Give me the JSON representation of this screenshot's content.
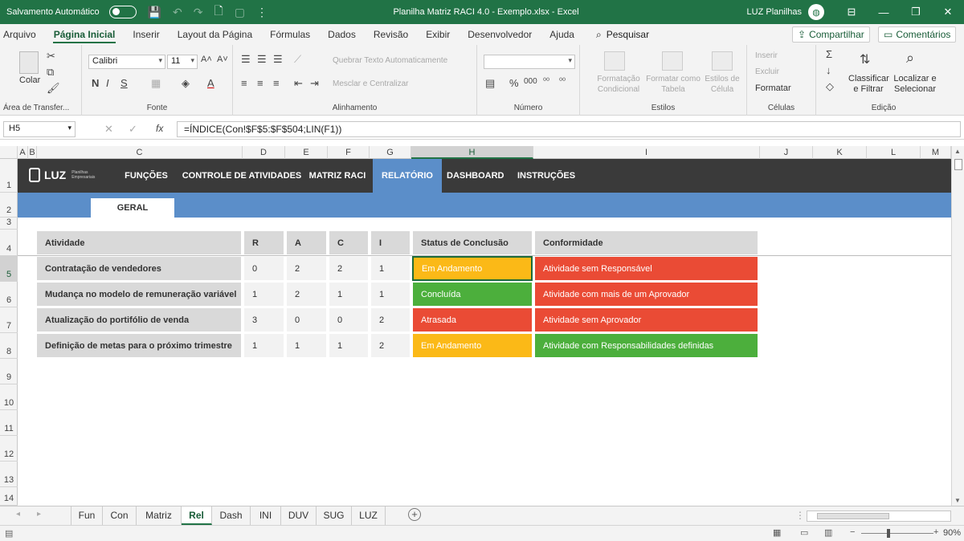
{
  "titlebar": {
    "autosave_label": "Salvamento Automático",
    "title": "Planilha Matriz RACI 4.0 - Exemplo.xlsx  -  Excel",
    "user": "LUZ Planilhas"
  },
  "menu": {
    "items": [
      "Arquivo",
      "Página Inicial",
      "Inserir",
      "Layout da Página",
      "Fórmulas",
      "Dados",
      "Revisão",
      "Exibir",
      "Desenvolvedor",
      "Ajuda"
    ],
    "search": "Pesquisar",
    "share": "Compartilhar",
    "comments": "Comentários"
  },
  "ribbon": {
    "clipboard": {
      "paste": "Colar",
      "label": "Área de Transfer..."
    },
    "font": {
      "name": "Calibri",
      "size": "11",
      "bold": "N",
      "italic": "I",
      "underline": "S",
      "label": "Fonte"
    },
    "alignment": {
      "wrap": "Quebrar Texto Automaticamente",
      "merge": "Mesclar e Centralizar",
      "label": "Alinhamento"
    },
    "number": {
      "format": "",
      "label": "Número"
    },
    "styles": {
      "conditional": "Formatação Condicional",
      "table": "Formatar como Tabela",
      "cell_styles": "Estilos de Célula",
      "label": "Estilos"
    },
    "cells": {
      "insert": "Inserir",
      "delete": "Excluir",
      "format": "Formatar",
      "label": "Células"
    },
    "editing": {
      "sort": "Classificar e Filtrar",
      "find": "Localizar e Selecionar",
      "label": "Edição"
    }
  },
  "formula": {
    "namebox": "H5",
    "formula": "=ÍNDICE(Con!$F$5:$F$504;LIN(F1))"
  },
  "columns": [
    "A",
    "B",
    "C",
    "D",
    "E",
    "F",
    "G",
    "H",
    "I",
    "J",
    "K",
    "L",
    "M"
  ],
  "rows": [
    "1",
    "2",
    "3",
    "4",
    "5",
    "6",
    "7",
    "8",
    "9",
    "10",
    "11",
    "12",
    "13",
    "14"
  ],
  "nav": {
    "logo": "LUZ",
    "logo_sub": "Planilhas Empresariais",
    "tabs": [
      "FUNÇÕES",
      "CONTROLE DE ATIVIDADES",
      "MATRIZ RACI",
      "RELATÓRIO",
      "DASHBOARD",
      "INSTRUÇÕES"
    ],
    "subtab": "GERAL"
  },
  "table": {
    "headers": [
      "Atividade",
      "R",
      "A",
      "C",
      "I",
      "Status de Conclusão",
      "Conformidade"
    ],
    "rows": [
      {
        "atividade": "Contratação de vendedores",
        "r": "0",
        "a": "2",
        "c": "2",
        "i": "1",
        "status": "Em Andamento",
        "conformidade": "Atividade sem Responsável"
      },
      {
        "atividade": "Mudança no modelo de remuneração variável",
        "r": "1",
        "a": "2",
        "c": "1",
        "i": "1",
        "status": "Concluída",
        "conformidade": "Atividade com mais de um Aprovador"
      },
      {
        "atividade": "Atualização do portifólio de venda",
        "r": "3",
        "a": "0",
        "c": "0",
        "i": "2",
        "status": "Atrasada",
        "conformidade": "Atividade sem Aprovador"
      },
      {
        "atividade": "Definição de metas para o próximo trimestre",
        "r": "1",
        "a": "1",
        "c": "1",
        "i": "2",
        "status": "Em Andamento",
        "conformidade": "Atividade com Responsabilidades definidas"
      }
    ]
  },
  "sheets": [
    "Fun",
    "Con",
    "Matriz",
    "Rel",
    "Dash",
    "INI",
    "DUV",
    "SUG",
    "LUZ"
  ],
  "status": {
    "zoom": "90%"
  },
  "colors": {
    "excel_green": "#217346",
    "nav_dark": "#3a3a3a",
    "nav_blue": "#5b8ec9",
    "in_progress": "#fbb917",
    "done": "#4caf3c",
    "late": "#ea4b35"
  }
}
